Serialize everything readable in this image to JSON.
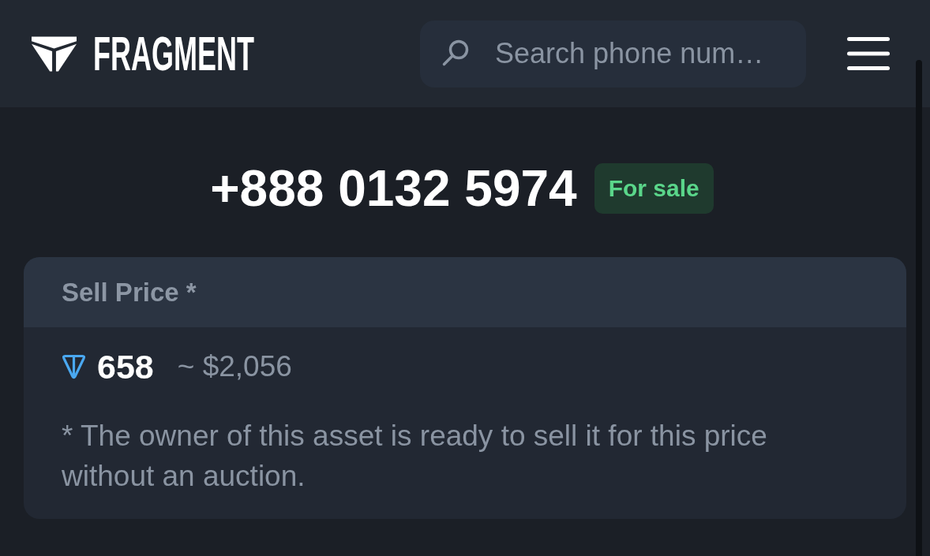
{
  "header": {
    "brand": "FRAGMENT",
    "search": {
      "placeholder": "Search phone num…"
    }
  },
  "listing": {
    "number": "+888 0132 5974",
    "status": "For sale"
  },
  "price_card": {
    "title": "Sell Price *",
    "amount": "658",
    "approx": "~ $2,056",
    "note": "* The owner of this asset is ready to sell it for this price without an auction."
  }
}
